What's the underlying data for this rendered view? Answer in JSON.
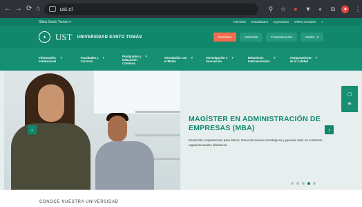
{
  "browser": {
    "url": "ust.cl",
    "back_icon": "←",
    "forward_icon": "→",
    "reload_icon": "⟳",
    "home_icon": "⌂",
    "actions": [
      "⚲",
      "☆",
      "●",
      "▼",
      "◐",
      "⧉",
      "●",
      "⋮"
    ]
  },
  "util_bar": {
    "selector": "Sitios Santo Tomás",
    "links": [
      "Admisión",
      "Estudiantes",
      "Egresados",
      "Oferta Sociales",
      "⌕"
    ]
  },
  "header": {
    "logo_text": "UST",
    "university_name": "UNIVERSIDAD SANTO TOMÁS",
    "buttons": [
      {
        "label": "Postúlate",
        "style": "primary"
      },
      {
        "label": "Matrícula",
        "style": "ghost"
      },
      {
        "label": "Financiamiento",
        "style": "ghost"
      },
      {
        "label": "Redes",
        "style": "ghost"
      }
    ]
  },
  "main_nav": {
    "items": [
      {
        "label": "Información\nInstitucional"
      },
      {
        "label": "Facultades y\nCarreras"
      },
      {
        "label": "Postgrados y\nEducación\nContinua"
      },
      {
        "label": "Vinculación con\nel Medio"
      },
      {
        "label": "Investigación e\nInnovación"
      },
      {
        "label": "Relaciones\nInternacionales"
      },
      {
        "label": "Aseguramiento\nde la Calidad"
      }
    ],
    "search_icon": "⌕"
  },
  "hero": {
    "title": "MAGÍSTER EN ADMINISTRACIÓN DE EMPRESAS (MBA)",
    "description": "Desarrolla competencias para liderar, tomar decisiones estratégicas y generar valor en contextos organizacionales dinámicos.",
    "prev_icon": "‹",
    "next_icon": "›",
    "dots": [
      false,
      false,
      false,
      true,
      false
    ]
  },
  "side_tab": {
    "icons": [
      "▢",
      "≋"
    ]
  },
  "section": {
    "title": "CONOCE NUESTRA UNIVERSIDAD"
  },
  "colors": {
    "brand_green": "#118a70",
    "accent_orange": "#f36b4d",
    "browser_dark": "#2f3238"
  }
}
